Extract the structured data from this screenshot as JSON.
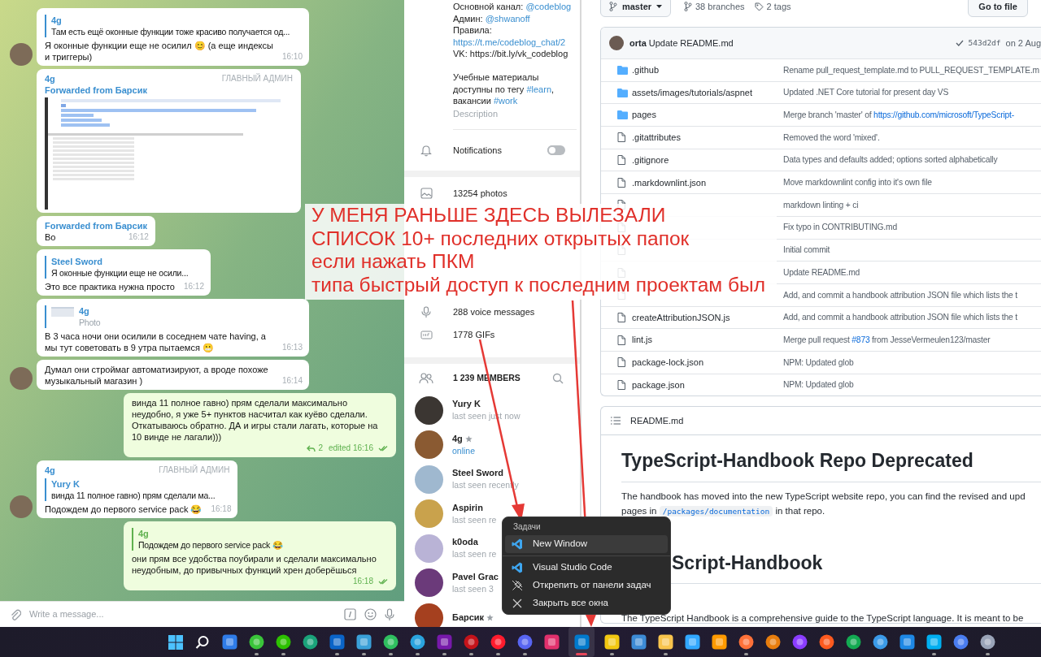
{
  "chat": {
    "messages": [
      {
        "kind": "in",
        "avatar": true,
        "reply": {
          "kind": "text",
          "author": "4g",
          "text": "Там есть ещё оконные функции тоже красиво получается од..."
        },
        "text": "Я оконные функции еще не осилил 😊 (а еще индексы и триггеры)",
        "time": "16:10"
      },
      {
        "kind": "in",
        "avatar": false,
        "author": "4g",
        "badge": "ГЛАВНЫЙ АДМИН",
        "forwarded": "Forwarded from Барсик",
        "image": true
      },
      {
        "kind": "in",
        "avatar": false,
        "forwarded": "Forwarded from Барсик",
        "text": "Во",
        "time": "16:12"
      },
      {
        "kind": "in",
        "avatar": false,
        "reply": {
          "kind": "text",
          "author": "Steel Sword",
          "text": "Я оконные функции еще не осили..."
        },
        "text": "Это все практика нужна просто",
        "time": "16:12"
      },
      {
        "kind": "in",
        "avatar": false,
        "reply": {
          "kind": "photo",
          "author": "4g",
          "text": "Photo"
        },
        "text": "В 3 часа ночи они осилили в соседнем чате having, а мы тут советовать в 9 утра пытаемся 😬",
        "time": "16:13"
      },
      {
        "kind": "in",
        "avatar": true,
        "text": "Думал они строймаг автоматизируют, а вроде похоже музыкальный магазин )",
        "time": "16:14"
      },
      {
        "kind": "out",
        "text": "винда 11 полное гавно) прям  сделали максимально неудобно, я уже 5+ пунктов насчитал как куёво сделали. Откатываюсь обратно. ДА и игры стали лагать, которые на 10 винде не лагали)))",
        "replies": "2",
        "time": "edited 16:16",
        "read": true
      },
      {
        "kind": "in",
        "avatar": true,
        "author": "4g",
        "badge": "ГЛАВНЫЙ АДМИН",
        "reply": {
          "kind": "text",
          "author": "Yury K",
          "text": "винда 11 полное гавно) прям  сделали ма..."
        },
        "text": "Подождем до первого service pack 😂",
        "time": "16:18"
      },
      {
        "kind": "out",
        "reply": {
          "kind": "text",
          "author": "4g",
          "text": "Подождем до первого service pack 😂"
        },
        "text": "они прям все удобства поубирали и сделали максимально неудобным, до привычных функций хрен доберёшься",
        "time": "16:18",
        "read": true
      }
    ],
    "composer": {
      "placeholder": "Write a message..."
    }
  },
  "group_info": {
    "description": [
      [
        [
          {
            "text": "Основной канал: "
          },
          {
            "text": "@codeblog",
            "link": true
          }
        ],
        [
          {
            "text": "Админ: "
          },
          {
            "text": "@shwanoff",
            "link": true
          }
        ],
        [
          {
            "text": "Правила:"
          }
        ],
        [
          {
            "text": "https://t.me/codeblog_chat/2",
            "link": true
          }
        ],
        [
          {
            "text": "VK: https://bit.ly/vk_codeblog"
          }
        ]
      ],
      [
        [
          {
            "text": "Учебные материалы"
          }
        ],
        [
          {
            "text": "доступны по тегу "
          },
          {
            "text": "#learn",
            "link": true
          },
          {
            "text": ","
          }
        ],
        [
          {
            "text": "вакансии "
          },
          {
            "text": "#work",
            "link": true
          }
        ]
      ]
    ],
    "description_label": "Description",
    "notifications": {
      "label": "Notifications",
      "on": false
    },
    "media": [
      {
        "kind": "photo",
        "label": "13254 photos"
      },
      {
        "kind": "voice",
        "label": "288 voice messages"
      },
      {
        "kind": "gif",
        "label": "1778 GIFs"
      }
    ],
    "members": {
      "title": "1 239 MEMBERS",
      "items": [
        {
          "name": "Yury K",
          "status": "last seen just now",
          "online": false,
          "starred": false
        },
        {
          "name": "4g",
          "status": "online",
          "online": true,
          "starred": true
        },
        {
          "name": "Steel Sword",
          "status": "last seen recently",
          "online": false,
          "starred": false
        },
        {
          "name": "Aspirin",
          "status": "last seen re",
          "online": false,
          "starred": false
        },
        {
          "name": "k0oda",
          "status": "last seen re",
          "online": false,
          "starred": false
        },
        {
          "name": "Pavel Grac",
          "status": "last seen 3",
          "online": false,
          "starred": false
        },
        {
          "name": "Барсик",
          "starred": true
        }
      ]
    }
  },
  "repo": {
    "branch": "master",
    "branches": "38 branches",
    "tags": "2 tags",
    "go_to_file": "Go to file",
    "commit": {
      "author": "orta",
      "message": "Update README.md",
      "sha": "543d2df",
      "date": "on 2 Aug"
    },
    "files": [
      {
        "kind": "folder",
        "name": ".github",
        "message": [
          {
            "text": "Rename pull_request_template.md to PULL_REQUEST_TEMPLATE.m"
          }
        ]
      },
      {
        "kind": "folder",
        "name": "assets/images/tutorials/aspnet",
        "message": [
          {
            "text": "Updated .NET Core tutorial for present day VS"
          }
        ]
      },
      {
        "kind": "folder",
        "name": "pages",
        "message": [
          {
            "text": "Merge branch 'master' of "
          },
          {
            "text": "https://github.com/microsoft/TypeScript-",
            "link": true
          }
        ]
      },
      {
        "kind": "file",
        "name": ".gitattributes",
        "message": [
          {
            "text": "Removed the word 'mixed'."
          }
        ]
      },
      {
        "kind": "file",
        "name": ".gitignore",
        "message": [
          {
            "text": "Data types and defaults added; options sorted alphabetically"
          }
        ]
      },
      {
        "kind": "file",
        "name": ".markdownlint.json",
        "message": [
          {
            "text": "Move markdownlint config into it's own file"
          }
        ]
      },
      {
        "kind": "file",
        "message": [
          {
            "text": "markdown linting + ci"
          }
        ]
      },
      {
        "kind": "file",
        "message": [
          {
            "text": "Fix typo in CONTRIBUTING.md"
          }
        ]
      },
      {
        "kind": "file",
        "message": [
          {
            "text": "Initial commit"
          }
        ]
      },
      {
        "kind": "file",
        "message": [
          {
            "text": "Update README.md"
          }
        ]
      },
      {
        "kind": "file",
        "message": [
          {
            "text": "Add, and commit a handbook attribution JSON file which lists the t"
          }
        ]
      },
      {
        "kind": "file",
        "name": "createAttributionJSON.js",
        "message": [
          {
            "text": "Add, and commit a handbook attribution JSON file which lists the t"
          }
        ]
      },
      {
        "kind": "file",
        "name": "lint.js",
        "message": [
          {
            "text": "Merge pull request "
          },
          {
            "text": "#873",
            "link": true
          },
          {
            "text": " from JesseVermeulen123/master"
          }
        ]
      },
      {
        "kind": "file",
        "name": "package-lock.json",
        "message": [
          {
            "text": "NPM: Updated glob"
          }
        ]
      },
      {
        "kind": "file",
        "name": "package.json",
        "message": [
          {
            "text": "NPM: Updated glob"
          }
        ]
      }
    ],
    "readme": {
      "title": "README.md",
      "heading": "TypeScript-Handbook Repo Deprecated",
      "paragraph": [
        [
          {
            "text": "The handbook has moved into the new TypeScript website repo, you can find the revised and upd"
          }
        ],
        [
          {
            "text": "pages in "
          },
          {
            "text": "/packages/documentation",
            "code": true
          },
          {
            "text": " in that repo."
          }
        ]
      ],
      "heading_2": "Script-Handbook",
      "last_line": "The TypeScript Handbook is a comprehensive guide to the TypeScript language. It is meant to be"
    }
  },
  "annotation": {
    "lines": [
      "У МЕНЯ РАНЬШЕ ЗДЕСЬ ВЫЛЕЗАЛИ",
      "СПИСОК 10+ последних открытых папок",
      "если нажать ПКМ",
      "типа быстрый доступ к последним проектам был"
    ]
  },
  "context_menu": {
    "title": "Задачи",
    "sections": [
      [
        {
          "label": "New Window",
          "kind": "app",
          "selected": true
        }
      ],
      [
        {
          "label": "Visual Studio Code",
          "kind": "app",
          "selected": false
        },
        {
          "label": "Открепить от панели задач",
          "kind": "unpin",
          "selected": false
        },
        {
          "label": "Закрыть все окна",
          "kind": "close",
          "selected": false
        }
      ]
    ]
  },
  "taskbar": {
    "items": [
      {
        "kind": "start",
        "color": "#4cc2ff",
        "open": false,
        "active": false
      },
      {
        "kind": "search",
        "color": "#ffffff",
        "open": false,
        "active": false
      },
      {
        "kind": "tile",
        "color": "#2f7ce8",
        "open": false,
        "active": false
      },
      {
        "kind": "circle",
        "color": "#3ac43a",
        "open": true,
        "active": false
      },
      {
        "kind": "circle",
        "color": "#2dc100",
        "open": true,
        "active": false
      },
      {
        "kind": "circle",
        "color": "#1aa37a",
        "open": false,
        "active": false
      },
      {
        "kind": "tile",
        "color": "#0a64c8",
        "open": true,
        "active": false
      },
      {
        "kind": "tile",
        "color": "#3aa0d8",
        "open": true,
        "active": false
      },
      {
        "kind": "circle",
        "color": "#2fbf5f",
        "open": true,
        "active": false
      },
      {
        "kind": "circle",
        "color": "#2aa3de",
        "open": true,
        "active": false
      },
      {
        "kind": "tile",
        "color": "#7719aa",
        "open": true,
        "active": false
      },
      {
        "kind": "circle",
        "color": "#c4131a",
        "open": true,
        "active": false
      },
      {
        "kind": "circle",
        "color": "#ff1b2d",
        "open": true,
        "active": false
      },
      {
        "kind": "circle",
        "color": "#5865f2",
        "open": true,
        "active": false
      },
      {
        "kind": "tile",
        "color": "#e1306c",
        "open": false,
        "active": false
      },
      {
        "kind": "tile",
        "color": "#007acc",
        "open": true,
        "active": true
      },
      {
        "kind": "tile",
        "color": "#f2c811",
        "open": true,
        "active": false
      },
      {
        "kind": "tile",
        "color": "#3d8bd6",
        "open": false,
        "active": false
      },
      {
        "kind": "tile",
        "color": "#f8c44d",
        "open": true,
        "active": false
      },
      {
        "kind": "tile",
        "color": "#31a8ff",
        "open": false,
        "active": false
      },
      {
        "kind": "tile",
        "color": "#ff9a00",
        "open": false,
        "active": false
      },
      {
        "kind": "circle",
        "color": "#ff7139",
        "open": true,
        "active": false
      },
      {
        "kind": "circle",
        "color": "#e87d0d",
        "open": false,
        "active": false
      },
      {
        "kind": "circle",
        "color": "#8b3dff",
        "open": false,
        "active": false
      },
      {
        "kind": "circle",
        "color": "#ff5a1f",
        "open": false,
        "active": false
      },
      {
        "kind": "circle",
        "color": "#13aa52",
        "open": false,
        "active": false
      },
      {
        "kind": "circle",
        "color": "#3b9ae8",
        "open": false,
        "active": false
      },
      {
        "kind": "tile",
        "color": "#1e88e5",
        "open": false,
        "active": false
      },
      {
        "kind": "tile",
        "color": "#00aff0",
        "open": true,
        "active": false
      },
      {
        "kind": "circle",
        "color": "#4a7df0",
        "open": false,
        "active": false
      },
      {
        "kind": "circle",
        "color": "#9aa4b8",
        "open": true,
        "active": false
      }
    ]
  }
}
